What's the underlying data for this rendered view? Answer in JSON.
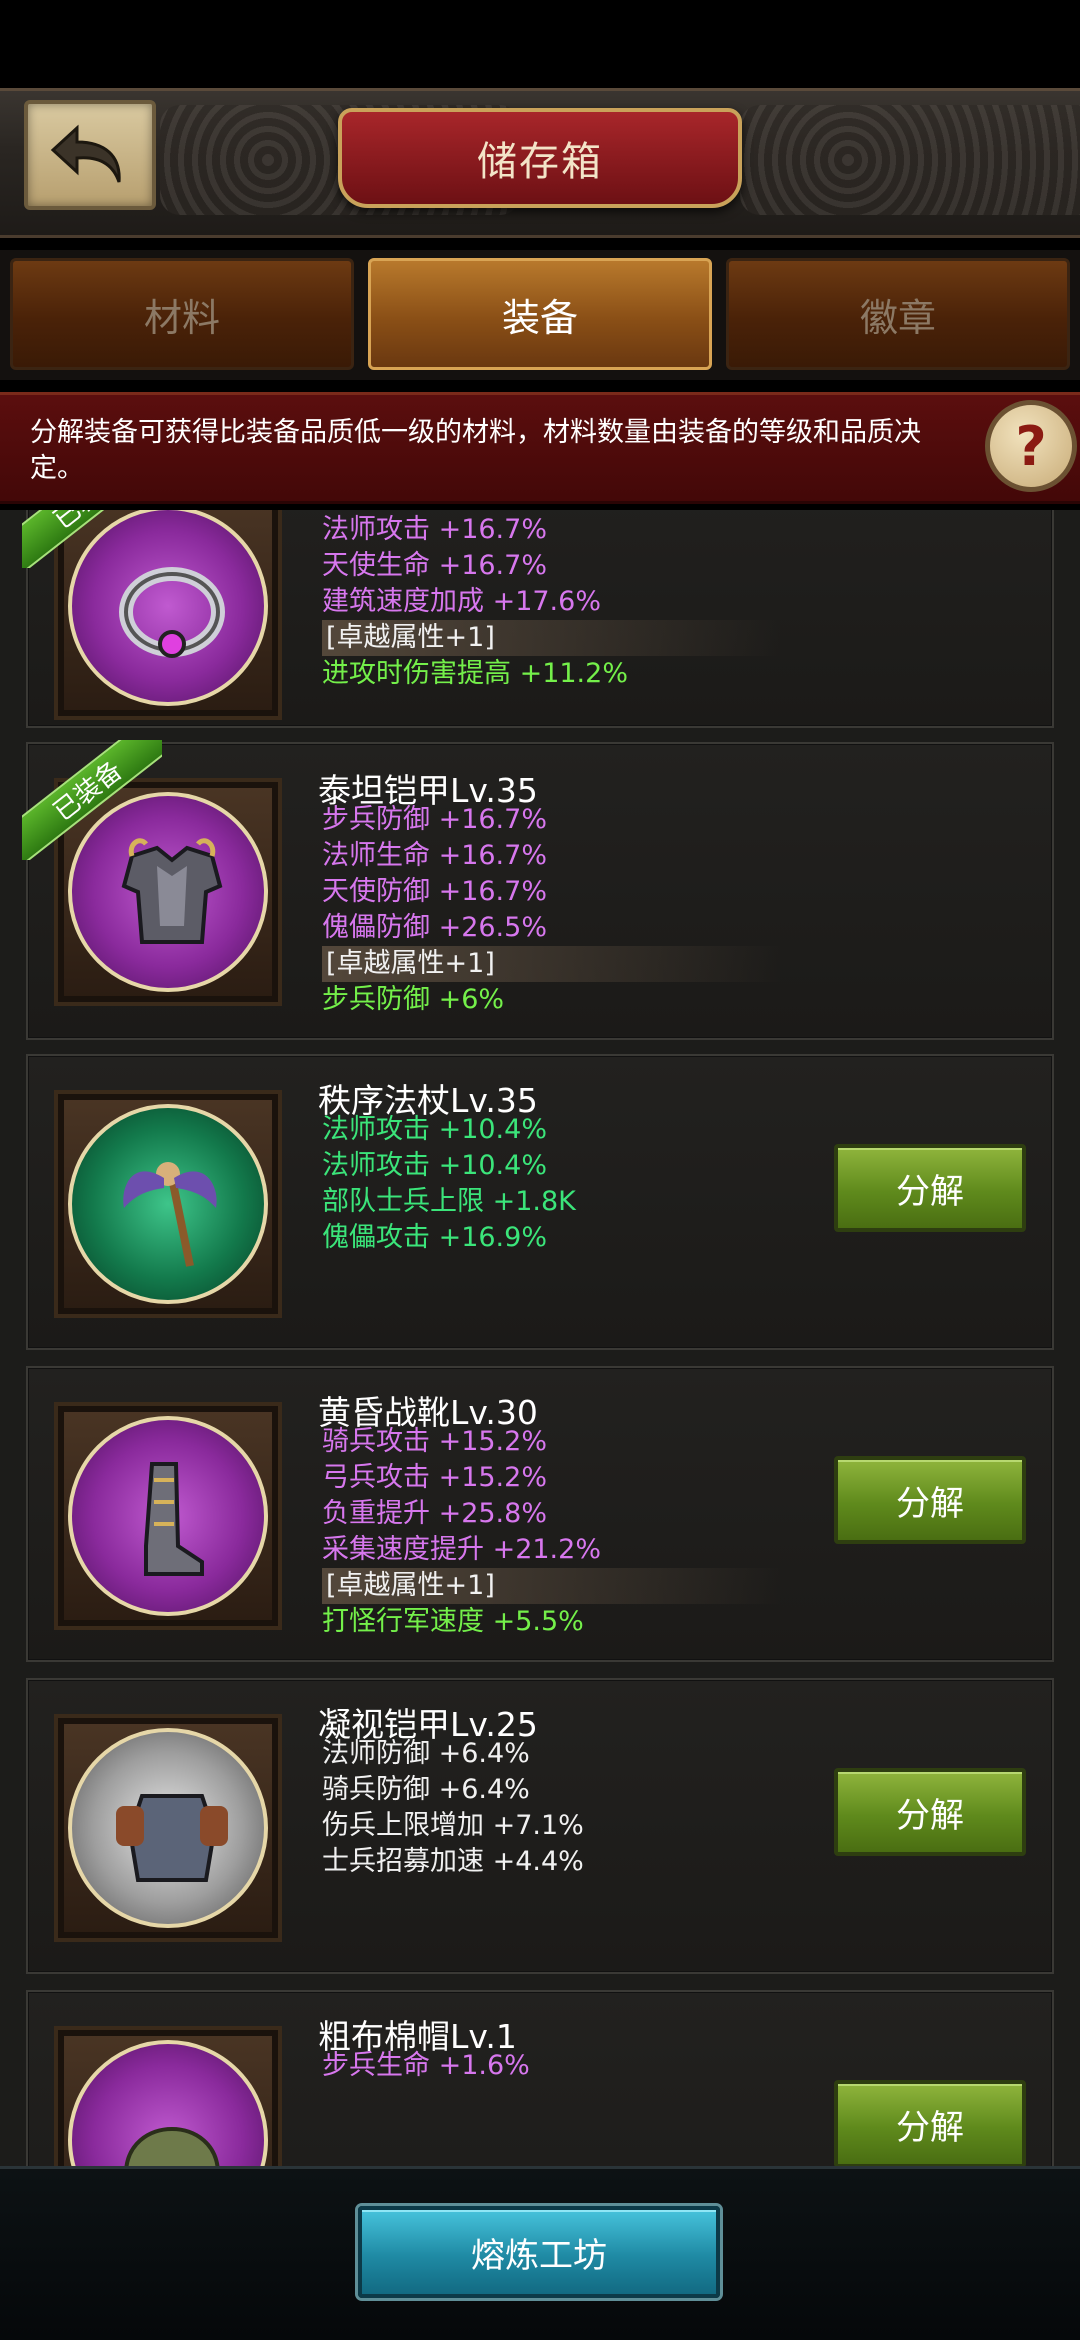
{
  "header": {
    "title": "储存箱"
  },
  "tabs": [
    {
      "label": "材料",
      "active": false
    },
    {
      "label": "装备",
      "active": true
    },
    {
      "label": "徽章",
      "active": false
    }
  ],
  "info": {
    "text": "分解装备可获得比装备品质低一级的材料，材料数量由装备的等级和品质决定。",
    "help": "?"
  },
  "equipped_tag": "已装备",
  "items": [
    {
      "name": "",
      "stats": [
        "法师攻击 +16.7%",
        "天使生命 +16.7%",
        "建筑速度加成 +17.6%",
        "[卓越属性+1]",
        "进攻时伤害提高 +11.2%"
      ]
    },
    {
      "name": "泰坦铠甲Lv.35",
      "stats": [
        "步兵防御 +16.7%",
        "法师生命 +16.7%",
        "天使防御 +16.7%",
        "傀儡防御 +26.5%",
        "[卓越属性+1]",
        "步兵防御 +6%"
      ]
    },
    {
      "name": "秩序法杖Lv.35",
      "stats": [
        "法师攻击 +10.4%",
        "法师攻击 +10.4%",
        "部队士兵上限 +1.8K",
        "傀儡攻击 +16.9%"
      ],
      "button": "分解"
    },
    {
      "name": "黄昏战靴Lv.30",
      "stats": [
        "骑兵攻击 +15.2%",
        "弓兵攻击 +15.2%",
        "负重提升 +25.8%",
        "采集速度提升 +21.2%",
        "[卓越属性+1]",
        "打怪行军速度 +5.5%"
      ],
      "button": "分解"
    },
    {
      "name": "凝视铠甲Lv.25",
      "stats": [
        "法师防御 +6.4%",
        "骑兵防御 +6.4%",
        "伤兵上限增加 +7.1%",
        "士兵招募加速 +4.4%"
      ],
      "button": "分解"
    },
    {
      "name": "粗布棉帽Lv.1",
      "stats": [
        "步兵生命 +1.6%"
      ],
      "button": "分解"
    }
  ],
  "footer": {
    "forge_button": "熔炼工坊"
  },
  "colors": {
    "rare_stat": "#d777ee",
    "uncommon_stat": "#3be57a",
    "bonus_stat": "#74f04a",
    "action_button": "#6f9a26",
    "forge_button": "#2aa3bd"
  }
}
